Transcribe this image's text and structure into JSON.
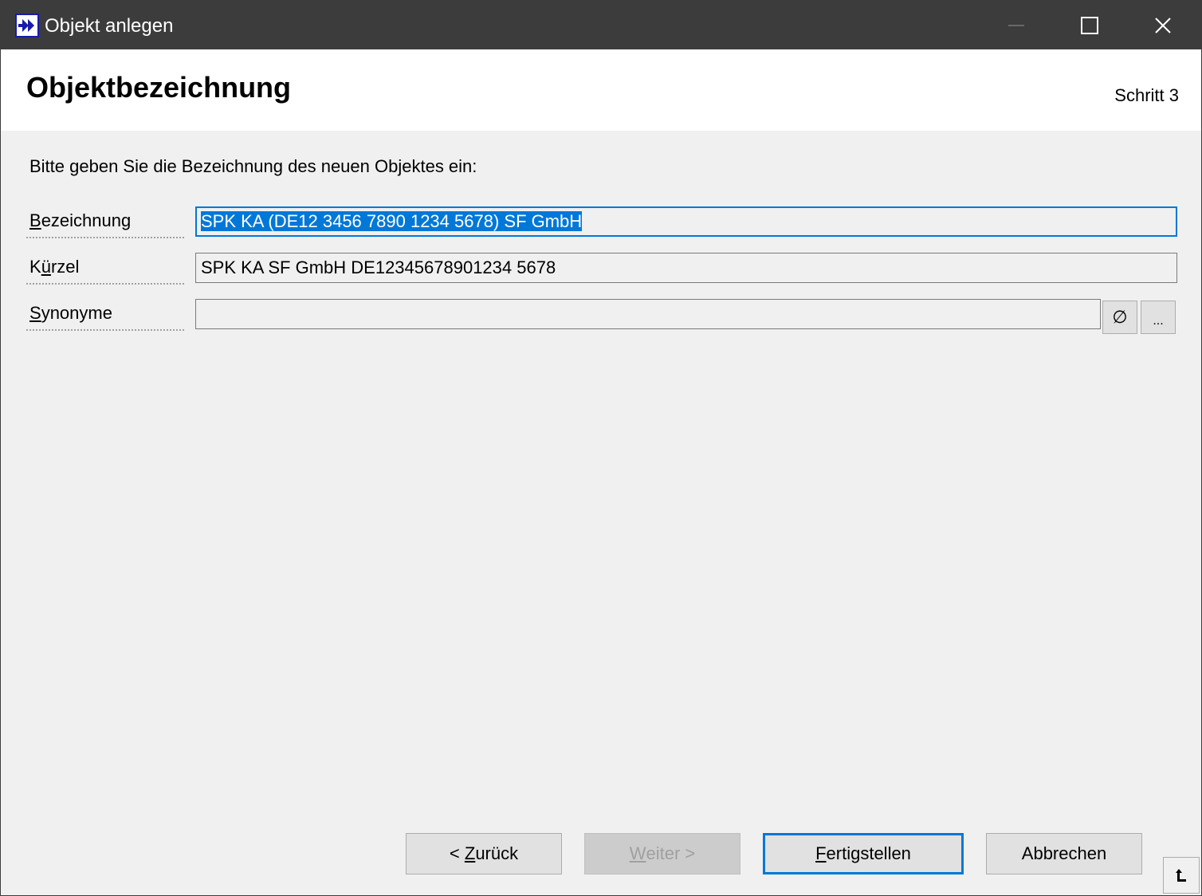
{
  "window": {
    "title": "Objekt anlegen",
    "icon": "double-arrow-right-icon"
  },
  "header": {
    "title": "Objektbezeichnung",
    "step": "Schritt 3"
  },
  "instruction": "Bitte geben Sie die Bezeichnung des neuen Objektes ein:",
  "fields": {
    "bezeichnung": {
      "label_mnemonic": "B",
      "label_rest": "ezeichnung",
      "value": "SPK KA (DE12 3456 7890 1234 5678) SF GmbH"
    },
    "kuerzel": {
      "label_first": "K",
      "label_mnemonic": "ü",
      "label_rest": "rzel",
      "value": "SPK KA SF GmbH DE12345678901234 5678"
    },
    "synonyme": {
      "label_mnemonic": "S",
      "label_rest": "ynonyme",
      "value": "",
      "clear_label": "∅",
      "browse_label": "..."
    }
  },
  "buttons": {
    "back_prefix": "< ",
    "back_mnemonic": "Z",
    "back_rest": "urück",
    "next_mnemonic": "W",
    "next_rest": "eiter >",
    "finish_mnemonic": "F",
    "finish_rest": "ertigstellen",
    "cancel": "Abbrechen"
  },
  "colors": {
    "titlebar": "#3c3c3c",
    "accent": "#0078d7",
    "background": "#f0f0f0"
  }
}
